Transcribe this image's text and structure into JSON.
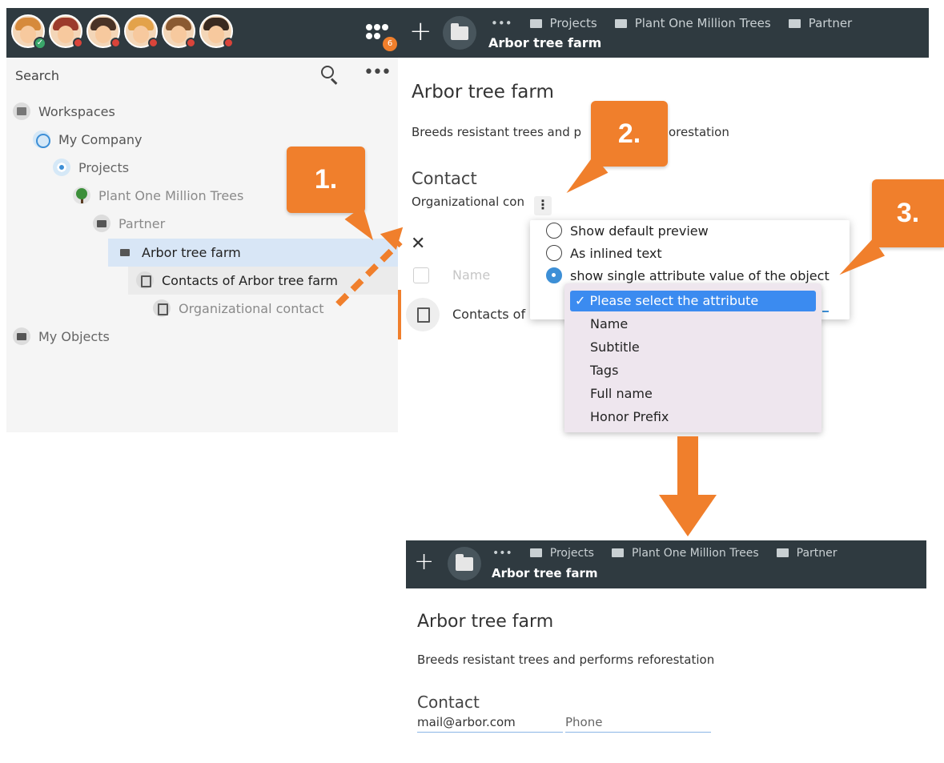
{
  "top": {
    "team_badge": "6",
    "breadcrumbs": [
      "Projects",
      "Plant One Million Trees",
      "Partner"
    ],
    "ellipsis": "•••",
    "title": "Arbor tree farm"
  },
  "avatars": [
    {
      "hair": "#d68a3c",
      "status": "ok"
    },
    {
      "hair": "#9c3b2b",
      "status": "busy"
    },
    {
      "hair": "#4a3326",
      "status": "busy"
    },
    {
      "hair": "#e3a24a",
      "status": "busy"
    },
    {
      "hair": "#8a5a32",
      "status": "busy"
    },
    {
      "hair": "#3a2a20",
      "status": "busy"
    }
  ],
  "sidebar": {
    "search_label": "Search",
    "more": "•••",
    "tree": [
      {
        "label": "Workspaces",
        "icon": "workspaces-icon"
      },
      {
        "label": "My Company",
        "icon": "company-icon"
      },
      {
        "label": "Projects",
        "icon": "projects-icon"
      },
      {
        "label": "Plant One Million Trees",
        "icon": "tree-icon"
      },
      {
        "label": "Partner",
        "icon": "folder-icon"
      },
      {
        "label": "Arbor tree farm",
        "icon": "folder-icon"
      },
      {
        "label": "Contacts of Arbor tree farm",
        "icon": "contact-book-icon"
      },
      {
        "label": "Organizational contact",
        "icon": "contact-book-icon"
      },
      {
        "label": "My Objects",
        "icon": "folder-icon"
      }
    ]
  },
  "main": {
    "title": "Arbor tree farm",
    "description_visible_left": "Breeds resistant trees and p",
    "description_visible_right": "orestation",
    "contact_heading": "Contact",
    "org_contact_partial": "Organizational con",
    "kebab": "⋮",
    "close": "✕",
    "column_name": "Name",
    "row_text_partial": "Contacts of",
    "popup_options": [
      {
        "label": "Show default preview",
        "selected": false
      },
      {
        "label": "As inlined text",
        "selected": false
      },
      {
        "label": "show single attribute value of the object",
        "selected": true
      }
    ],
    "dropdown": {
      "selected": "✓ Please select the attribute",
      "options": [
        "Name",
        "Subtitle",
        "Tags",
        "Full name",
        "Honor Prefix"
      ]
    }
  },
  "callouts": [
    "1.",
    "2.",
    "3."
  ],
  "result": {
    "breadcrumbs": [
      "Projects",
      "Plant One Million Trees",
      "Partner"
    ],
    "ellipsis": "•••",
    "bar_title": "Arbor tree farm",
    "title": "Arbor tree farm",
    "description": "Breeds resistant trees and performs reforestation",
    "contact_heading": "Contact",
    "email": "mail@arbor.com",
    "phone_placeholder": "Phone"
  },
  "colors": {
    "accent": "#f07f2c",
    "bar": "#2f3a40",
    "selection": "#d8e6f6",
    "primary": "#3b8bf0"
  }
}
